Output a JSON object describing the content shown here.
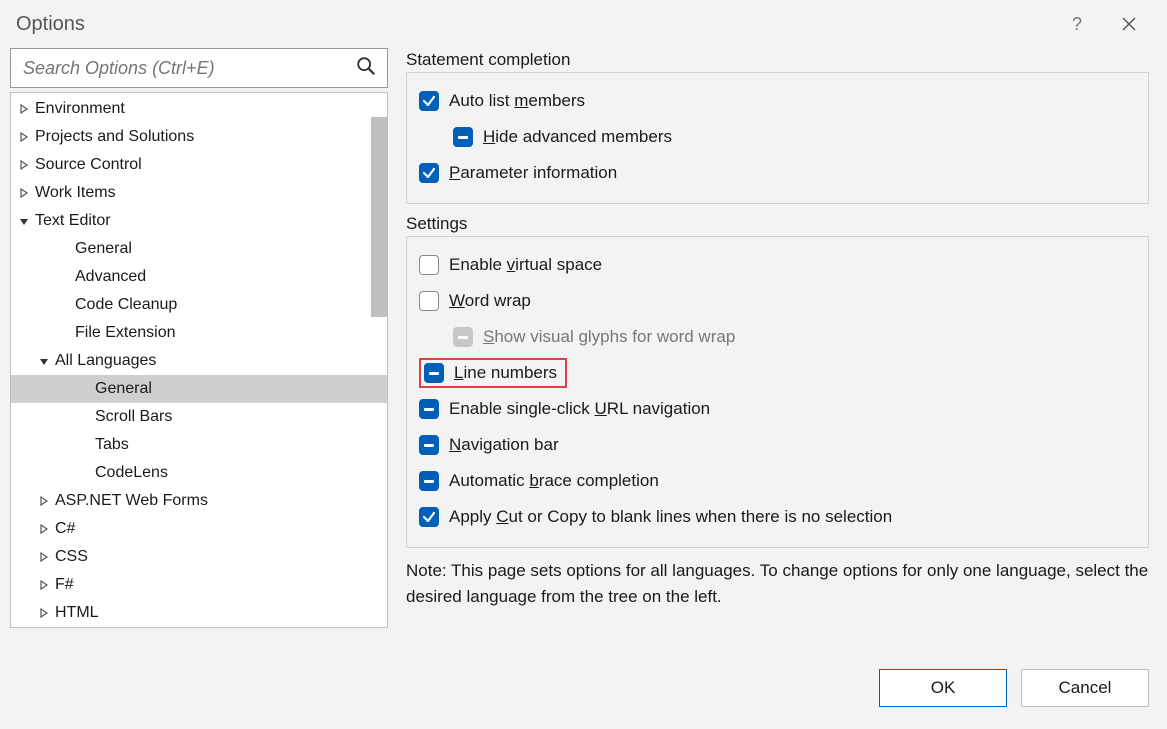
{
  "window": {
    "title": "Options"
  },
  "search": {
    "placeholder": "Search Options (Ctrl+E)"
  },
  "tree": {
    "items": [
      {
        "label": "Environment",
        "depth": 0,
        "exp": "closed"
      },
      {
        "label": "Projects and Solutions",
        "depth": 0,
        "exp": "closed"
      },
      {
        "label": "Source Control",
        "depth": 0,
        "exp": "closed"
      },
      {
        "label": "Work Items",
        "depth": 0,
        "exp": "closed"
      },
      {
        "label": "Text Editor",
        "depth": 0,
        "exp": "open"
      },
      {
        "label": "General",
        "depth": 1,
        "exp": "none"
      },
      {
        "label": "Advanced",
        "depth": 1,
        "exp": "none"
      },
      {
        "label": "Code Cleanup",
        "depth": 1,
        "exp": "none"
      },
      {
        "label": "File Extension",
        "depth": 1,
        "exp": "none"
      },
      {
        "label": "All Languages",
        "depth": 1,
        "exp": "open"
      },
      {
        "label": "General",
        "depth": 2,
        "exp": "none",
        "selected": true
      },
      {
        "label": "Scroll Bars",
        "depth": 2,
        "exp": "none"
      },
      {
        "label": "Tabs",
        "depth": 2,
        "exp": "none"
      },
      {
        "label": "CodeLens",
        "depth": 2,
        "exp": "none"
      },
      {
        "label": "ASP.NET Web Forms",
        "depth": 1,
        "exp": "closed"
      },
      {
        "label": "C#",
        "depth": 1,
        "exp": "closed"
      },
      {
        "label": "CSS",
        "depth": 1,
        "exp": "closed"
      },
      {
        "label": "F#",
        "depth": 1,
        "exp": "closed"
      },
      {
        "label": "HTML",
        "depth": 1,
        "exp": "closed"
      }
    ]
  },
  "groups": {
    "statement": {
      "title": "Statement completion",
      "auto_list": {
        "pre": "Auto list ",
        "ul": "m",
        "post": "embers"
      },
      "hide_adv": {
        "pre": "",
        "ul": "H",
        "post": "ide advanced members"
      },
      "param_info": {
        "pre": "",
        "ul": "P",
        "post": "arameter information"
      }
    },
    "settings": {
      "title": "Settings",
      "virtual": {
        "pre": "Enable ",
        "ul": "v",
        "post": "irtual space"
      },
      "wrap": {
        "pre": "",
        "ul": "W",
        "post": "ord wrap"
      },
      "glyphs": {
        "pre": "",
        "ul": "S",
        "post": "how visual glyphs for word wrap"
      },
      "line_num": {
        "pre": "",
        "ul": "L",
        "post": "ine numbers"
      },
      "url_nav": {
        "pre": "Enable single-click ",
        "ul": "U",
        "post": "RL navigation"
      },
      "nav_bar": {
        "pre": "",
        "ul": "N",
        "post": "avigation bar"
      },
      "brace": {
        "pre": "Automatic ",
        "ul": "b",
        "post": "race completion"
      },
      "cutcopy": {
        "pre": "Apply ",
        "ul": "C",
        "post": "ut or Copy to blank lines when there is no selection"
      }
    }
  },
  "note": "Note: This page sets options for all languages. To change options for only one language, select the desired language from the tree on the left.",
  "buttons": {
    "ok": "OK",
    "cancel": "Cancel"
  }
}
